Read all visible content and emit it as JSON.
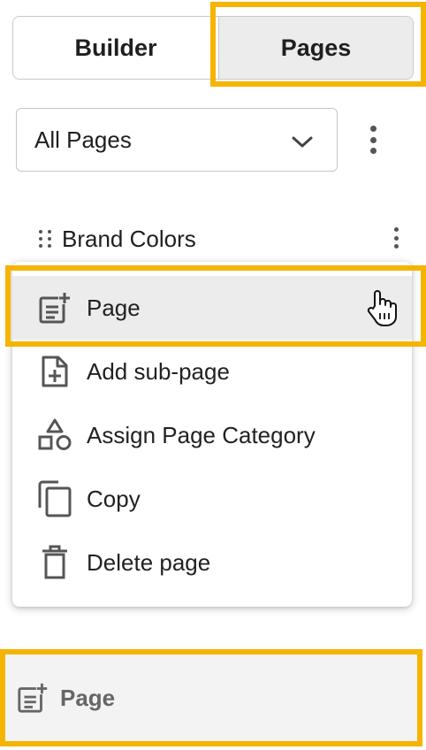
{
  "tabs": {
    "builder_label": "Builder",
    "pages_label": "Pages",
    "active": "Pages"
  },
  "filter": {
    "selected": "All Pages"
  },
  "page_list": {
    "items": [
      {
        "label": "Brand Colors"
      }
    ]
  },
  "context_menu": {
    "items": [
      {
        "label": "Page",
        "icon": "post-add-icon",
        "active": true
      },
      {
        "label": "Add sub-page",
        "icon": "note-add-icon"
      },
      {
        "label": "Assign Page Category",
        "icon": "category-icon"
      },
      {
        "label": "Copy",
        "icon": "copy-icon"
      },
      {
        "label": "Delete page",
        "icon": "trash-icon"
      }
    ]
  },
  "bottom_button": {
    "label": "Page",
    "icon": "post-add-icon"
  },
  "colors": {
    "highlight": "#f5b400",
    "active_bg": "#ececec",
    "icon": "#555555"
  }
}
